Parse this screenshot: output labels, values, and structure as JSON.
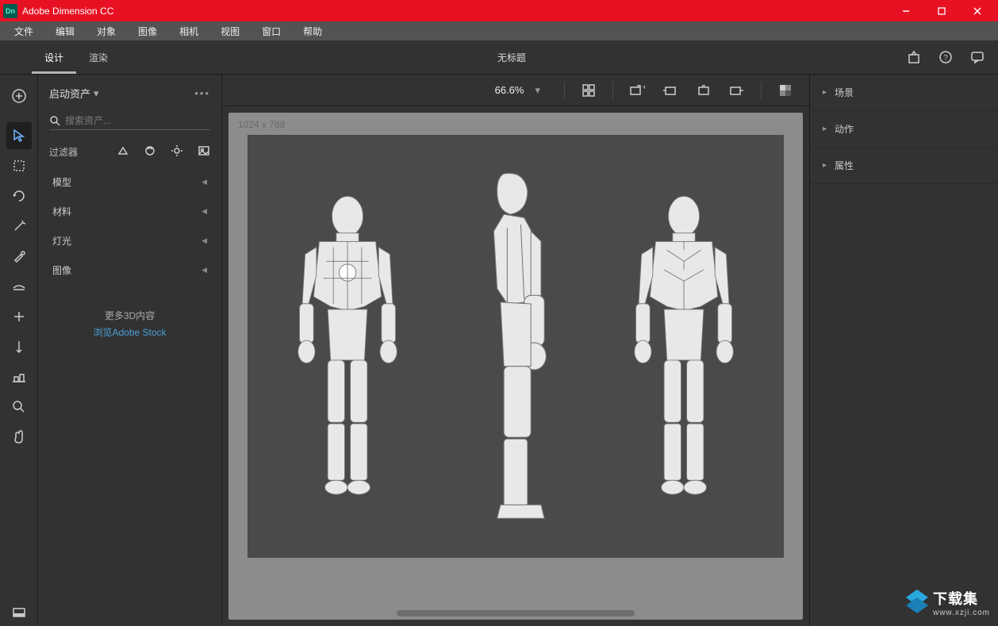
{
  "titlebar": {
    "app_name": "Adobe Dimension CC",
    "logo_text": "Dn"
  },
  "menubar": {
    "items": [
      "文件",
      "编辑",
      "对象",
      "图像",
      "相机",
      "视图",
      "窗口",
      "帮助"
    ]
  },
  "modebar": {
    "tabs": [
      {
        "label": "设计",
        "active": true
      },
      {
        "label": "渲染",
        "active": false
      }
    ],
    "doc_title": "无标题"
  },
  "assets": {
    "header": "启动资产",
    "search_placeholder": "搜索资产...",
    "filters_label": "过滤器",
    "categories": [
      "模型",
      "材料",
      "灯光",
      "图像"
    ],
    "promo_text": "更多3D内容",
    "promo_link": "浏览Adobe Stock"
  },
  "canvas": {
    "zoom": "66.6%",
    "render_dims": "1024 x 768"
  },
  "rpanel": {
    "sections": [
      "场景",
      "动作",
      "属性"
    ]
  },
  "watermark": {
    "name": "下载集",
    "url": "www.xzji.com"
  }
}
